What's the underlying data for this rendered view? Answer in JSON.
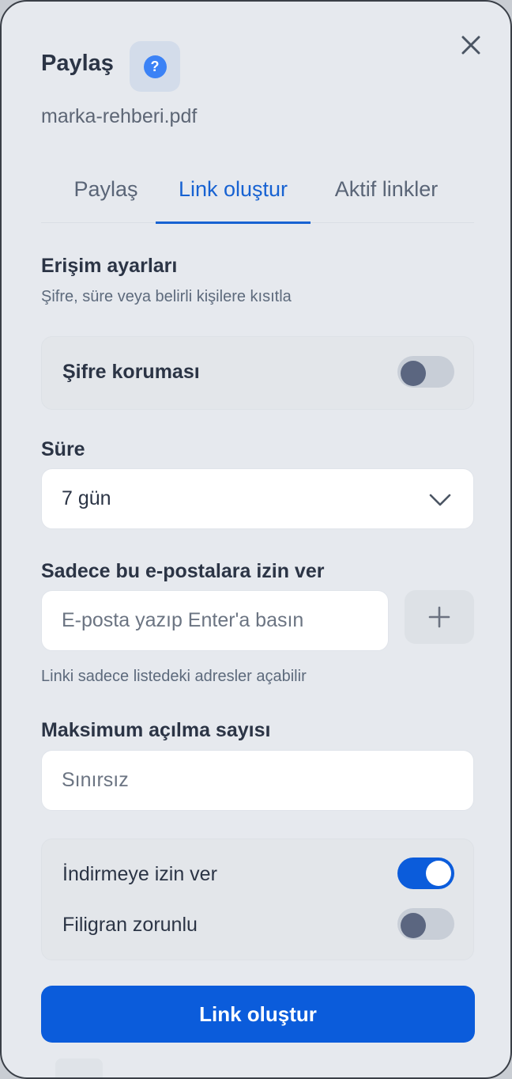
{
  "dialog": {
    "title": "Paylaş",
    "help_glyph": "?",
    "filename": "marka-rehberi.pdf"
  },
  "tabs": [
    {
      "label": "Paylaş",
      "active": false
    },
    {
      "label": "Link oluştur",
      "active": true
    },
    {
      "label": "Aktif linkler",
      "active": false
    }
  ],
  "access": {
    "title": "Erişim ayarları",
    "subtitle": "Şifre, süre veya belirli kişilere kısıtla",
    "password_label": "Şifre koruması",
    "password_enabled": false
  },
  "duration": {
    "label": "Süre",
    "selected": "7 gün"
  },
  "emails": {
    "label": "Sadece bu e-postalara izin ver",
    "placeholder": "E-posta yazıp Enter'a basın",
    "add_glyph": "+",
    "hint": "Linki sadece listedeki adresler açabilir"
  },
  "max_opens": {
    "label": "Maksimum açılma sayısı",
    "placeholder": "Sınırsız"
  },
  "options": {
    "download_label": "İndirmeye izin ver",
    "download_enabled": true,
    "watermark_label": "Filigran zorunlu",
    "watermark_enabled": false
  },
  "create_button": "Link oluştur",
  "colors": {
    "accent": "#0b5cdb",
    "help_icon": "#3b82f6",
    "panel_bg": "#e6e9ee"
  },
  "icons": {
    "help": "help-icon",
    "close": "close-icon",
    "dropdown": "chevron-down-icon",
    "add": "plus-icon"
  }
}
